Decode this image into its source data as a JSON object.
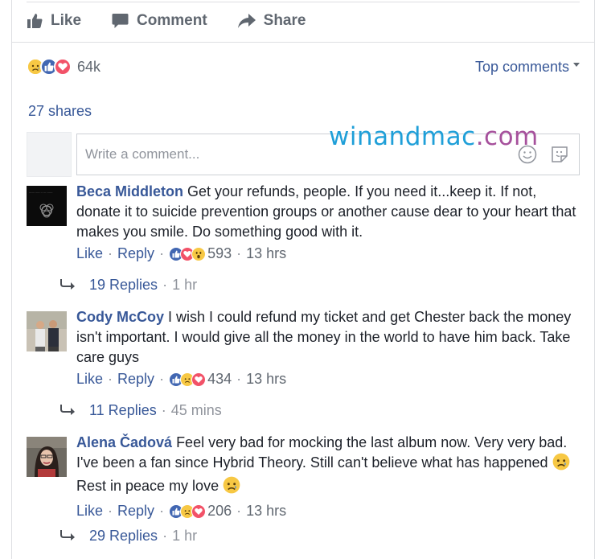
{
  "actions": {
    "like": "Like",
    "comment": "Comment",
    "share": "Share"
  },
  "reactions": {
    "count": "64k",
    "types": [
      "sad",
      "like",
      "love"
    ],
    "sort_label": "Top comments"
  },
  "shares": "27 shares",
  "composer": {
    "placeholder": "Write a comment..."
  },
  "watermark": {
    "part1": "winandmac",
    "part2": ".com"
  },
  "comments": [
    {
      "name": "Beca Middleton",
      "text": "Get your refunds, people. If you need it...keep it. If not, donate it to suicide prevention groups or another cause dear to your heart that makes you smile. Do something good with it.",
      "like": "Like",
      "reply": "Reply",
      "reactions": [
        "like",
        "love",
        "wow"
      ],
      "reaction_count": "593",
      "time": "13 hrs",
      "replies": "19 Replies",
      "replies_time": "1 hr"
    },
    {
      "name": "Cody McCoy",
      "text": "I wish I could refund my ticket and get Chester back the money isn't important. I would give all the money in the world to have him back. Take care guys",
      "like": "Like",
      "reply": "Reply",
      "reactions": [
        "like",
        "sad",
        "love"
      ],
      "reaction_count": "434",
      "time": "13 hrs",
      "replies": "11 Replies",
      "replies_time": "45 mins"
    },
    {
      "name": "Alena Čadová",
      "text_a": "Feel very bad for mocking the last album now. Very very bad. I've been a fan since Hybrid Theory. Still can't believe what has happened",
      "text_b": "Rest in peace my love",
      "like": "Like",
      "reply": "Reply",
      "reactions": [
        "like",
        "sad",
        "love"
      ],
      "reaction_count": "206",
      "time": "13 hrs",
      "replies": "29 Replies",
      "replies_time": "1 hr"
    }
  ],
  "colors": {
    "link": "#385898",
    "like_blue": "#4267b2",
    "love_red": "#f25268",
    "sad_yellow": "#f7c844",
    "muted": "#606770"
  }
}
